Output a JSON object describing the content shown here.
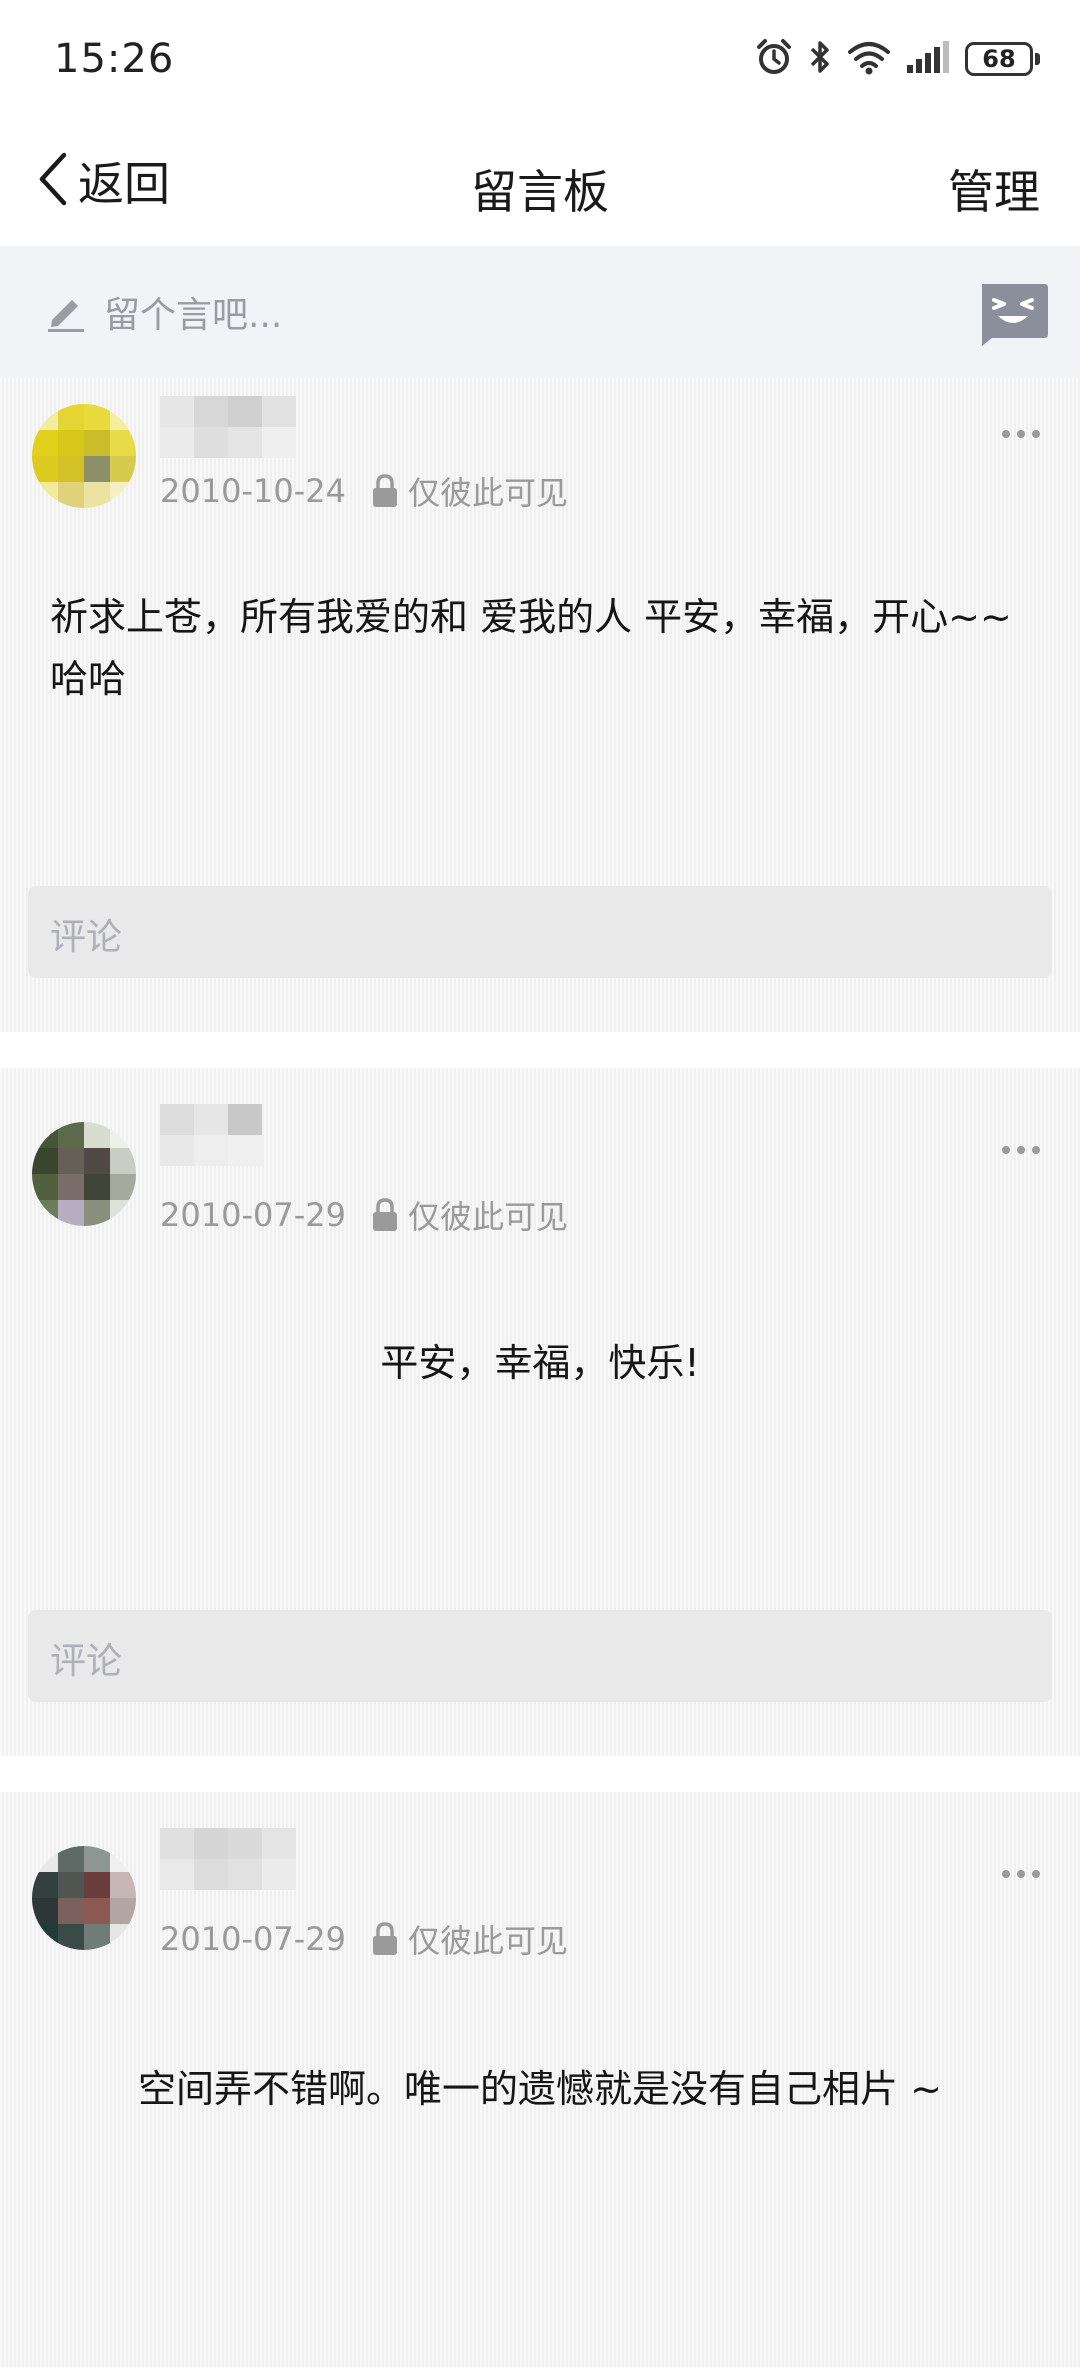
{
  "status_bar": {
    "time": "15:26",
    "battery": "68",
    "icons": [
      "alarm-icon",
      "bluetooth-icon",
      "wifi-icon",
      "signal-icon",
      "battery-icon"
    ]
  },
  "nav": {
    "back_label": "返回",
    "title": "留言板",
    "manage_label": "管理"
  },
  "compose": {
    "placeholder": "留个言吧..."
  },
  "messages": [
    {
      "date": "2010-10-24",
      "visibility": "仅彼此可见",
      "text": "祈求上苍，所有我爱的和 爱我的人 平安，幸福，开心~~哈哈",
      "comment_placeholder": "评论"
    },
    {
      "date": "2010-07-29",
      "visibility": "仅彼此可见",
      "text": "平安，幸福，快乐!",
      "comment_placeholder": "评论"
    },
    {
      "date": "2010-07-29",
      "visibility": "仅彼此可见",
      "text": "空间弄不错啊。唯一的遗憾就是没有自己相片 ~",
      "comment_placeholder": ""
    }
  ]
}
